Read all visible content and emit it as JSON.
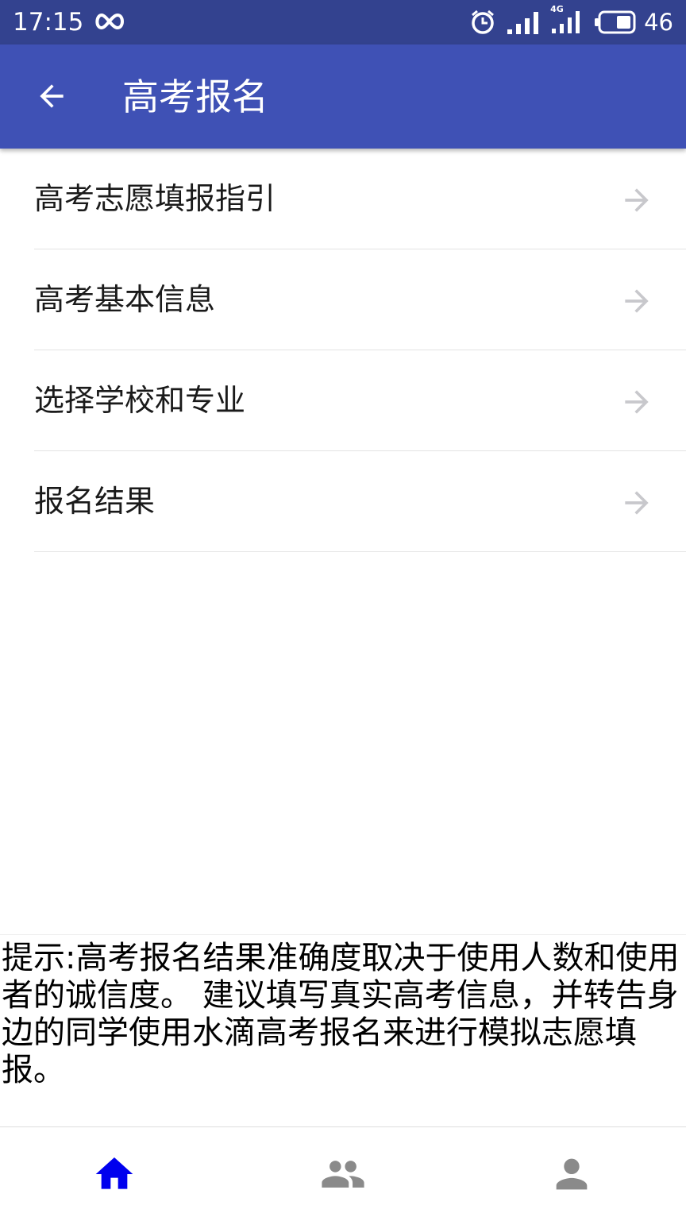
{
  "status_bar": {
    "time": "17:15",
    "network_label": "4G",
    "battery_level": "46"
  },
  "app_bar": {
    "title": "高考报名"
  },
  "menu": {
    "items": [
      {
        "label": "高考志愿填报指引"
      },
      {
        "label": "高考基本信息"
      },
      {
        "label": "选择学校和专业"
      },
      {
        "label": "报名结果"
      }
    ]
  },
  "hint": {
    "text": "提示:高考报名结果准确度取决于使用人数和使用者的诚信度。 建议填写真实高考信息，并转告身边的同学使用水滴高考报名来进行模拟志愿填报。"
  },
  "bottom_nav": {
    "tabs": [
      {
        "icon": "home-icon",
        "active": true
      },
      {
        "icon": "group-icon",
        "active": false
      },
      {
        "icon": "person-icon",
        "active": false
      }
    ],
    "active_color": "#0000ee",
    "inactive_color": "#8a8a8a"
  },
  "colors": {
    "status_bar": "#33428f",
    "app_bar": "#3f51b5",
    "arrow": "#c8c8cc"
  }
}
